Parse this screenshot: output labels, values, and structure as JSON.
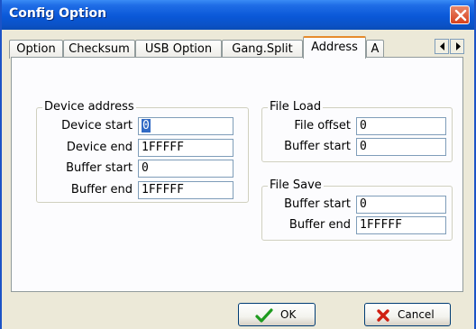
{
  "window": {
    "title": "Config Option"
  },
  "tabs": [
    {
      "label": "Option"
    },
    {
      "label": "Checksum"
    },
    {
      "label": "USB Option"
    },
    {
      "label": "Gang.Split"
    },
    {
      "label": "Address"
    },
    {
      "label": "A"
    }
  ],
  "active_tab": "Address",
  "device_address": {
    "title": "Device address",
    "fields": [
      {
        "label": "Device start",
        "value": "0"
      },
      {
        "label": "Device end",
        "value": "1FFFFF"
      },
      {
        "label": "Buffer start",
        "value": "0"
      },
      {
        "label": "Buffer end",
        "value": "1FFFFF"
      }
    ]
  },
  "file_load": {
    "title": "File Load",
    "fields": [
      {
        "label": "File offset",
        "value": "0"
      },
      {
        "label": "Buffer start",
        "value": "0"
      }
    ]
  },
  "file_save": {
    "title": "File Save",
    "fields": [
      {
        "label": "Buffer start",
        "value": "0"
      },
      {
        "label": "Buffer end",
        "value": "1FFFFF"
      }
    ]
  },
  "buttons": {
    "ok": "OK",
    "cancel": "Cancel"
  },
  "colors": {
    "titlebar": "#0a58d8",
    "ok_icon": "#1e9b1e",
    "cancel_icon": "#d01f12",
    "active_tab_accent": "#e68b2c"
  }
}
